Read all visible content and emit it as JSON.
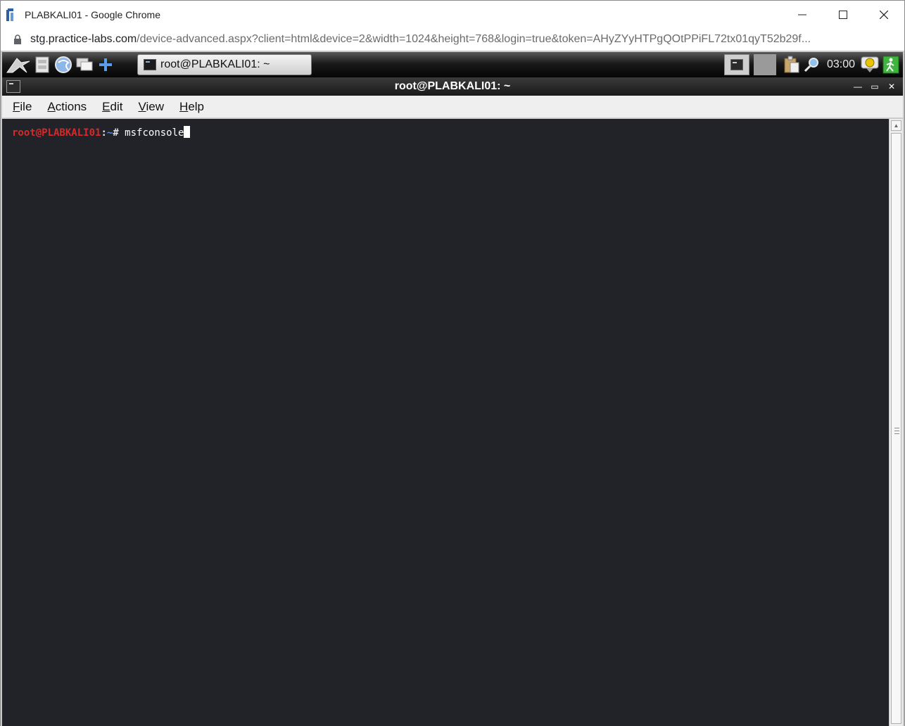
{
  "browser": {
    "window_title": "PLABKALI01 - Google Chrome",
    "url_host": "stg.practice-labs.com",
    "url_path": "/device-advanced.aspx?client=html&device=2&width=1024&height=768&login=true&token=AHyZYyHTPgQOtPPiFL72tx01qyT52b29f..."
  },
  "panel": {
    "taskbar_item_label": "root@PLABKALI01: ~",
    "clock": "03:00",
    "icons": [
      "kali-dragon-icon",
      "file-manager-icon",
      "browser-icon",
      "show-desktop-icon",
      "add-icon",
      "terminal-tray-icon",
      "clipboard-icon",
      "search-icon",
      "notification-icon",
      "logout-icon"
    ]
  },
  "terminal_window": {
    "title": "root@PLABKALI01: ~",
    "menu": [
      {
        "mnemonic": "F",
        "rest": "ile"
      },
      {
        "mnemonic": "A",
        "rest": "ctions"
      },
      {
        "mnemonic": "E",
        "rest": "dit"
      },
      {
        "mnemonic": "V",
        "rest": "iew"
      },
      {
        "mnemonic": "H",
        "rest": "elp"
      }
    ],
    "prompt": {
      "user_host": "root@PLABKALI01",
      "separator": ":",
      "directory": "~",
      "symbol": "# ",
      "command": "msfconsole"
    }
  },
  "colors": {
    "terminal_bg": "#222329",
    "prompt_user": "#d62a2a",
    "prompt_dir": "#4f8fe6"
  }
}
